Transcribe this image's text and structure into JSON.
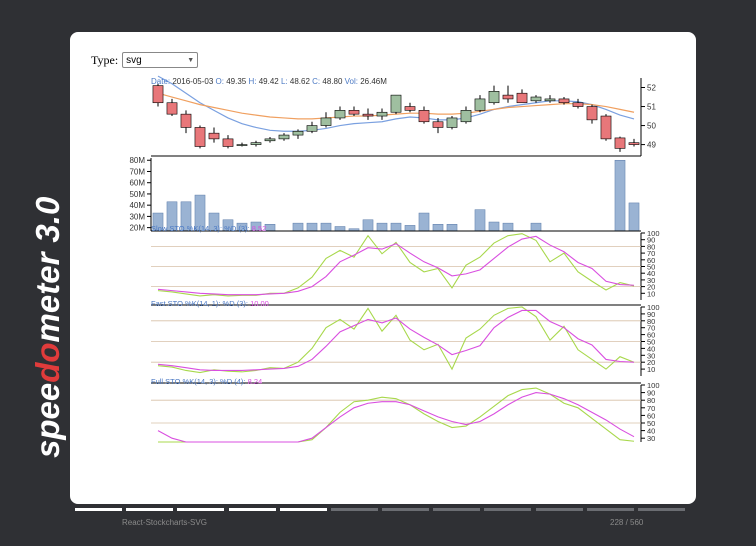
{
  "brand": {
    "name": "speedometer",
    "part1": "spee",
    "part2": "do",
    "part3": "meter",
    "version": "3.0"
  },
  "controls": {
    "type_label": "Type:",
    "type_value": "svg"
  },
  "tooltip": {
    "date_label": "Date:",
    "date": "2016-05-03",
    "o_label": "O:",
    "open": "49.35",
    "h_label": "H:",
    "high": "49.42",
    "l_label": "L:",
    "low": "48.62",
    "c_label": "C:",
    "close": "48.80",
    "vol_label": "Vol:",
    "vol": "26.46M"
  },
  "indicators": {
    "slow": {
      "label": "Slow STO %K(14, 3): %D (3):",
      "value": "8.52"
    },
    "fast": {
      "label": "Fast STO %K(14, 1): %D (3):",
      "value": "10.00"
    },
    "full": {
      "label": "Full STO %K(14, 3): %D (4):",
      "value": "8.24"
    }
  },
  "footer": {
    "title": "React-Stockcharts-SVG",
    "page": "228 / 560"
  },
  "progress": {
    "segments_total": 12,
    "segments_done": 5
  },
  "colors": {
    "background": "#2f3034",
    "frame": "#ffffff",
    "brand_accent": "#e03b3b",
    "candle_up": "#9fbfa0",
    "candle_down": "#e8777a",
    "volume": "#9ab3d3",
    "ema_fast": "#7aa0e0",
    "ema_slow": "#f0a060",
    "k_line": "#a8d84c",
    "d_line": "#d94fe0",
    "stoch_band": "#d7c0a8"
  },
  "chart_data": [
    {
      "type": "candlestick",
      "x": [
        1,
        2,
        3,
        4,
        5,
        6,
        7,
        8,
        9,
        10,
        11,
        12,
        13,
        14,
        15,
        16,
        17,
        18,
        19,
        20,
        21,
        22,
        23,
        24,
        25,
        26,
        27,
        28,
        29,
        30,
        31,
        32,
        33,
        34,
        35
      ],
      "open": [
        52.1,
        51.2,
        50.6,
        49.9,
        49.6,
        49.3,
        49.0,
        49.0,
        49.2,
        49.3,
        49.5,
        49.7,
        50.0,
        50.4,
        50.8,
        50.6,
        50.5,
        50.7,
        51.0,
        50.8,
        50.2,
        49.9,
        50.2,
        50.8,
        51.2,
        51.6,
        51.7,
        51.3,
        51.3,
        51.4,
        51.2,
        51.0,
        50.5,
        49.35,
        49.1
      ],
      "high": [
        52.2,
        51.4,
        50.8,
        50.0,
        49.9,
        49.5,
        49.1,
        49.2,
        49.4,
        49.6,
        49.8,
        50.2,
        50.7,
        51.0,
        51.0,
        50.9,
        50.9,
        51.6,
        51.2,
        51.0,
        50.4,
        50.5,
        51.0,
        51.6,
        52.1,
        52.1,
        51.9,
        51.6,
        51.6,
        51.5,
        51.4,
        51.1,
        50.6,
        49.42,
        49.3
      ],
      "low": [
        51.0,
        50.5,
        49.6,
        48.8,
        49.1,
        48.8,
        48.9,
        48.9,
        49.1,
        49.2,
        49.3,
        49.6,
        49.9,
        50.3,
        50.5,
        50.3,
        50.3,
        50.6,
        50.7,
        50.1,
        49.6,
        49.8,
        50.1,
        50.7,
        51.1,
        51.2,
        51.2,
        51.2,
        51.2,
        51.1,
        50.9,
        50.1,
        49.2,
        48.62,
        48.9
      ],
      "close": [
        51.2,
        50.6,
        49.9,
        48.9,
        49.3,
        48.9,
        49.0,
        49.1,
        49.3,
        49.5,
        49.7,
        50.0,
        50.4,
        50.8,
        50.6,
        50.5,
        50.7,
        51.6,
        50.8,
        50.2,
        49.9,
        50.4,
        50.8,
        51.4,
        51.8,
        51.4,
        51.2,
        51.5,
        51.4,
        51.2,
        51.0,
        50.3,
        49.3,
        48.8,
        49.0
      ],
      "ema_fast": [
        52.6,
        52.2,
        51.7,
        51.2,
        50.8,
        50.4,
        50.1,
        49.9,
        49.75,
        49.7,
        49.7,
        49.75,
        49.85,
        50.0,
        50.1,
        50.15,
        50.2,
        50.35,
        50.45,
        50.4,
        50.3,
        50.3,
        50.4,
        50.6,
        50.85,
        51.0,
        51.1,
        51.2,
        51.3,
        51.3,
        51.25,
        51.1,
        50.85,
        50.55,
        50.35
      ],
      "ema_slow": [
        51.7,
        51.5,
        51.3,
        51.1,
        50.95,
        50.8,
        50.65,
        50.55,
        50.45,
        50.4,
        50.35,
        50.35,
        50.4,
        50.45,
        50.5,
        50.5,
        50.55,
        50.6,
        50.65,
        50.65,
        50.6,
        50.6,
        50.65,
        50.75,
        50.85,
        50.95,
        51.0,
        51.05,
        51.1,
        51.15,
        51.15,
        51.1,
        51.0,
        50.85,
        50.7
      ],
      "ylim": [
        48.4,
        52.5
      ],
      "yticks": [
        "49",
        "50",
        "51",
        "52"
      ]
    },
    {
      "type": "bar",
      "x": [
        1,
        2,
        3,
        4,
        5,
        6,
        7,
        8,
        9,
        10,
        11,
        12,
        13,
        14,
        15,
        16,
        17,
        18,
        19,
        20,
        21,
        22,
        23,
        24,
        25,
        26,
        27,
        28,
        29,
        30,
        31,
        32,
        33,
        34,
        35
      ],
      "values": [
        33,
        43,
        43,
        49,
        33,
        27,
        24,
        25,
        23,
        15,
        24,
        24,
        24,
        21,
        19,
        27,
        24,
        24,
        22,
        33,
        23,
        23,
        12,
        36,
        25,
        24,
        13,
        24,
        14,
        15,
        17,
        16,
        17,
        80,
        42
      ],
      "ylim": [
        17,
        82
      ],
      "yticks": [
        "20M",
        "30M",
        "40M",
        "50M",
        "60M",
        "70M",
        "80M"
      ]
    },
    {
      "type": "line",
      "series": [
        {
          "values": [
            14,
            12,
            9,
            6,
            8,
            6,
            7,
            7,
            10,
            10,
            18,
            34,
            62,
            74,
            64,
            96,
            69,
            86,
            56,
            42,
            47,
            18,
            52,
            64,
            85,
            96,
            99,
            89,
            57,
            70,
            42,
            28,
            15,
            26,
            21
          ]
        },
        {
          "values": [
            16,
            14,
            12,
            10,
            9,
            8,
            8,
            8,
            9,
            10,
            13,
            20,
            35,
            57,
            67,
            78,
            76,
            84,
            70,
            57,
            48,
            36,
            39,
            45,
            62,
            79,
            91,
            95,
            82,
            72,
            56,
            47,
            28,
            23,
            22
          ]
        }
      ],
      "ylim": [
        0,
        100
      ],
      "yticks": [
        "10",
        "20",
        "30",
        "40",
        "50",
        "60",
        "70",
        "80",
        "90",
        "100"
      ]
    },
    {
      "type": "line",
      "series": [
        {
          "values": [
            15,
            13,
            8,
            5,
            9,
            7,
            6,
            8,
            12,
            11,
            20,
            40,
            70,
            82,
            68,
            98,
            65,
            88,
            52,
            38,
            46,
            10,
            55,
            68,
            88,
            98,
            100,
            86,
            52,
            72,
            38,
            24,
            10,
            28,
            20
          ]
        },
        {
          "values": [
            17,
            15,
            12,
            9,
            8,
            8,
            8,
            9,
            10,
            11,
            14,
            24,
            43,
            64,
            73,
            82,
            77,
            84,
            68,
            56,
            45,
            31,
            37,
            44,
            70,
            85,
            95,
            95,
            79,
            70,
            54,
            45,
            24,
            21,
            20
          ]
        }
      ],
      "ylim": [
        0,
        100
      ],
      "yticks": [
        "10",
        "20",
        "30",
        "40",
        "50",
        "60",
        "70",
        "80",
        "90",
        "100"
      ]
    },
    {
      "type": "line",
      "series": [
        {
          "values": [
            10,
            8,
            7,
            6,
            6,
            6,
            7,
            8,
            10,
            13,
            18,
            28,
            44,
            64,
            78,
            80,
            84,
            82,
            74,
            62,
            52,
            44,
            46,
            58,
            72,
            86,
            94,
            96,
            88,
            76,
            70,
            56,
            42,
            28,
            26
          ]
        },
        {
          "values": [
            40,
            30,
            22,
            16,
            12,
            10,
            10,
            10,
            12,
            14,
            20,
            30,
            44,
            58,
            70,
            76,
            78,
            78,
            74,
            66,
            58,
            52,
            48,
            52,
            62,
            74,
            84,
            90,
            88,
            82,
            74,
            64,
            54,
            42,
            32
          ]
        }
      ],
      "ylim": [
        25,
        100
      ],
      "yticks": [
        "30",
        "40",
        "50",
        "60",
        "70",
        "80",
        "90",
        "100"
      ]
    }
  ]
}
